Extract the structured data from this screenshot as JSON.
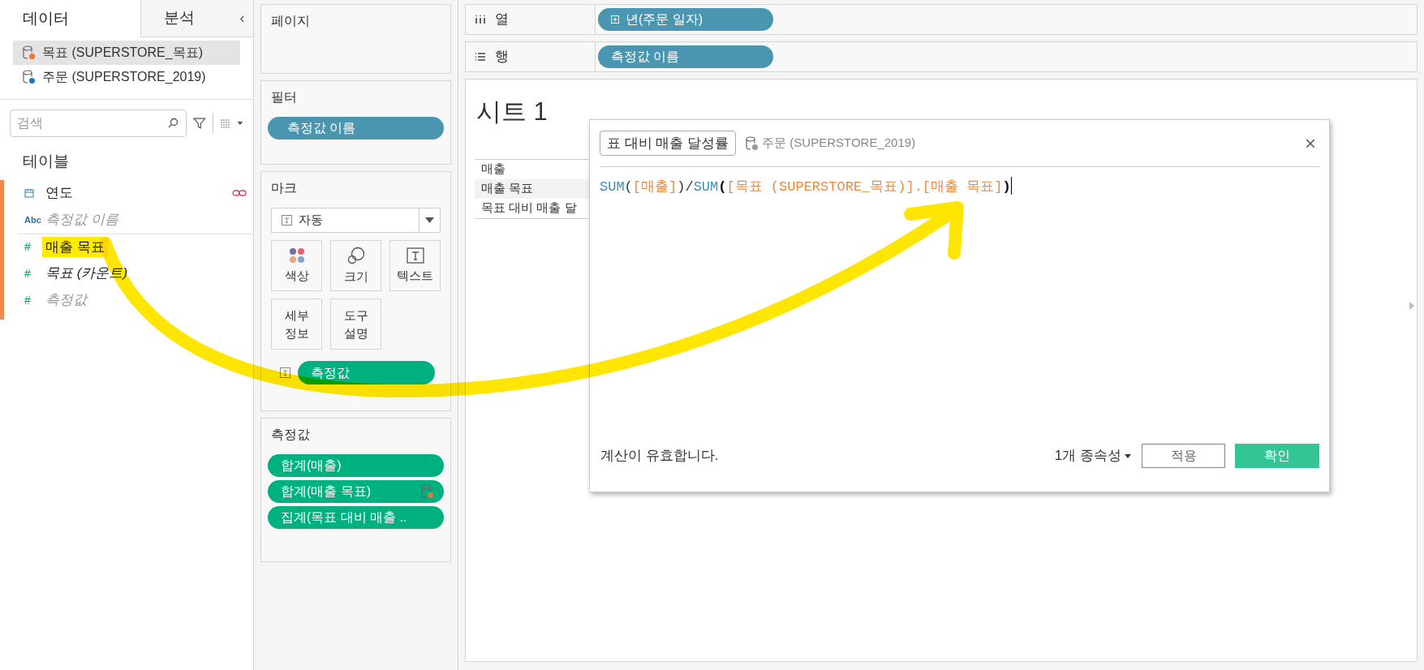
{
  "left_panel": {
    "tabs": [
      {
        "label": "데이터",
        "selected": true
      },
      {
        "label": "분석",
        "selected": false
      }
    ],
    "collapse": "‹",
    "data_sources": [
      {
        "name": "목표 (SUPERSTORE_목표)",
        "selected": true,
        "kind": "secondary"
      },
      {
        "name": "주문 (SUPERSTORE_2019)",
        "selected": false,
        "kind": "primary"
      }
    ],
    "search": {
      "placeholder": "검색"
    },
    "section_title": "테이블",
    "fields": [
      {
        "name": "연도",
        "kind": "date",
        "italic": false,
        "dimmed": false,
        "linked": true,
        "highlighted": false
      },
      {
        "name": "측정값 이름",
        "kind": "text",
        "type_label": "Abc",
        "italic": true,
        "dimmed": true,
        "linked": false,
        "highlighted": false
      },
      {
        "name": "매출 목표",
        "kind": "number",
        "type_label": "#",
        "italic": false,
        "dimmed": false,
        "linked": false,
        "highlighted": true,
        "divider_above": true
      },
      {
        "name": "목표 (카운트)",
        "kind": "number",
        "type_label": "#",
        "italic": true,
        "dimmed": false,
        "linked": false,
        "highlighted": false
      },
      {
        "name": "측정값",
        "kind": "number",
        "type_label": "#",
        "italic": true,
        "dimmed": true,
        "linked": false,
        "highlighted": false
      }
    ]
  },
  "cards": {
    "pages": {
      "title": "페이지"
    },
    "filters": {
      "title": "필터",
      "pills": [
        {
          "label": "측정값 이름",
          "kind": "dimension"
        }
      ]
    },
    "marks": {
      "title": "마크",
      "mark_type": "자동",
      "buttons": [
        {
          "label": "색상",
          "kind": "color"
        },
        {
          "label": "크기",
          "kind": "size"
        },
        {
          "label": "텍스트",
          "kind": "text"
        },
        {
          "label": "세부\n정보",
          "kind": "detail"
        },
        {
          "label": "도구\n설명",
          "kind": "tooltip"
        }
      ],
      "pills": [
        {
          "label": "측정값",
          "kind": "measure"
        }
      ]
    },
    "measure_values": {
      "title": "측정값",
      "pills": [
        {
          "label": "합계(매출)",
          "kind": "measure",
          "linked": false
        },
        {
          "label": "합계(매출 목표)",
          "kind": "measure",
          "linked": true
        },
        {
          "label": "집계(목표 대비 매출 ..",
          "kind": "measure",
          "linked": false
        }
      ]
    }
  },
  "shelves": [
    {
      "label": "열",
      "kind": "columns",
      "pills": [
        {
          "label": "년(주문 일자)",
          "kind": "dimension",
          "expandable": true
        }
      ]
    },
    {
      "label": "행",
      "kind": "rows",
      "pills": [
        {
          "label": "측정값 이름",
          "kind": "dimension",
          "expandable": false
        }
      ]
    }
  ],
  "sheet": {
    "title": "시트 1",
    "row_headers": [
      {
        "label": "매출",
        "selected": false
      },
      {
        "label": "매출 목표",
        "selected": true
      },
      {
        "label": "목표 대비 매출 달",
        "selected": false
      }
    ]
  },
  "dialog": {
    "name": "표 대비 매출 달성률",
    "source": "주문 (SUPERSTORE_2019)",
    "close": "×",
    "formula": [
      {
        "text": "SUM",
        "kind": "function"
      },
      {
        "text": "(",
        "kind": "punct"
      },
      {
        "text": "[매출]",
        "kind": "field"
      },
      {
        "text": ")",
        "kind": "punct"
      },
      {
        "text": "/",
        "kind": "punct"
      },
      {
        "text": "SUM",
        "kind": "function"
      },
      {
        "text": "(",
        "kind": "match"
      },
      {
        "text": "[목표 (SUPERSTORE_목표)].[매출 목표]",
        "kind": "field"
      },
      {
        "text": ")",
        "kind": "match"
      }
    ],
    "status": "계산이 유효합니다.",
    "dependencies": "1개 종속성",
    "apply": "적용",
    "ok": "확인"
  },
  "annotation": {
    "kind": "arrow"
  }
}
